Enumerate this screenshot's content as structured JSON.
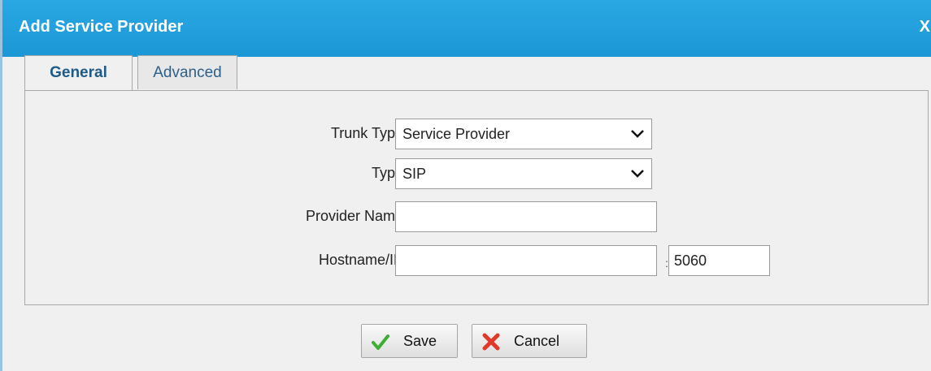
{
  "window": {
    "title": "Add Service Provider",
    "close_label": "X"
  },
  "tabs": [
    {
      "label": "General",
      "active": true
    },
    {
      "label": "Advanced",
      "active": false
    }
  ],
  "form": {
    "trunk_type": {
      "label": "Trunk Type:",
      "value": "Service Provider"
    },
    "type": {
      "label": "Type:",
      "value": "SIP"
    },
    "provider_name": {
      "label": "Provider Name:",
      "value": ""
    },
    "hostname": {
      "label": "Hostname/IP:",
      "value": "",
      "separator": ":",
      "port": "5060"
    }
  },
  "buttons": {
    "save": {
      "label": "Save",
      "icon": "check-icon"
    },
    "cancel": {
      "label": "Cancel",
      "icon": "x-icon"
    }
  },
  "colors": {
    "titlebar": "#1c97d6",
    "save_icon": "#3cae32",
    "cancel_icon": "#e03a2a"
  }
}
